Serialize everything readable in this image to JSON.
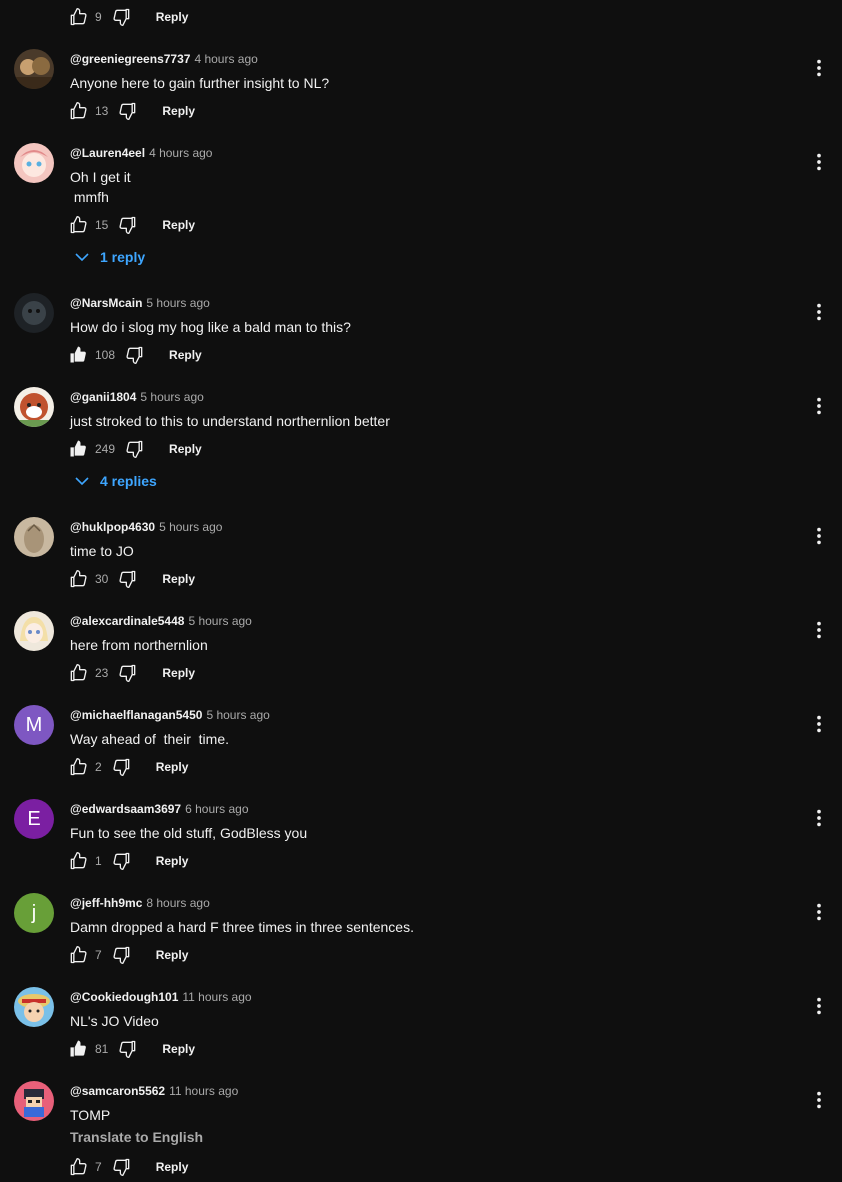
{
  "top_row": {
    "likes": "9",
    "reply_label": "Reply"
  },
  "comments": [
    {
      "handle": "@greeniegreens7737",
      "time": "4 hours ago",
      "text": "Anyone here to gain further insight to NL?",
      "likes": "13",
      "reply_label": "Reply"
    },
    {
      "handle": "@Lauren4eel",
      "time": "4 hours ago",
      "text": "Oh I get it\n mmfh",
      "likes": "15",
      "reply_label": "Reply",
      "replies": "1 reply"
    },
    {
      "handle": "@NarsMcain",
      "time": "5 hours ago",
      "text": "How do i slog my hog like a bald man to this?",
      "likes": "108",
      "reply_label": "Reply"
    },
    {
      "handle": "@ganii1804",
      "time": "5 hours ago",
      "text": "just stroked to this to understand northernlion better",
      "likes": "249",
      "reply_label": "Reply",
      "replies": "4 replies"
    },
    {
      "handle": "@huklpop4630",
      "time": "5 hours ago",
      "text": "time to JO",
      "likes": "30",
      "reply_label": "Reply"
    },
    {
      "handle": "@alexcardinale5448",
      "time": "5 hours ago",
      "text": "here from northernlion",
      "likes": "23",
      "reply_label": "Reply"
    },
    {
      "handle": "@michaelflanagan5450",
      "time": "5 hours ago",
      "text": "Way ahead of  their  time.",
      "likes": "2",
      "reply_label": "Reply",
      "avatar_letter": "M"
    },
    {
      "handle": "@edwardsaam3697",
      "time": "6 hours ago",
      "text": "Fun to see the old stuff, GodBless you",
      "likes": "1",
      "reply_label": "Reply",
      "avatar_letter": "E"
    },
    {
      "handle": "@jeff-hh9mc",
      "time": "8 hours ago",
      "text": "Damn dropped a hard F three times in three sentences.",
      "likes": "7",
      "reply_label": "Reply",
      "avatar_letter": "j"
    },
    {
      "handle": "@Cookiedough101",
      "time": "11 hours ago",
      "text": "NL's JO Video",
      "likes": "81",
      "reply_label": "Reply"
    },
    {
      "handle": "@samcaron5562",
      "time": "11 hours ago",
      "text": "TOMP",
      "translate": "Translate to English",
      "likes": "7",
      "reply_label": "Reply"
    }
  ],
  "colors": {
    "background": "#0f0f0f",
    "text": "#f1f1f1",
    "secondary_text": "#aaaaaa",
    "link_blue": "#3ea6ff",
    "avatar_m": "#7e57c2",
    "avatar_e": "#7b1fa2",
    "avatar_j": "#689f38"
  },
  "icons": {
    "like": "thumbs-up-icon",
    "like_active": "thumbs-up-filled-icon",
    "dislike": "thumbs-down-icon",
    "more": "more-vert-icon",
    "expand": "chevron-down-icon"
  }
}
